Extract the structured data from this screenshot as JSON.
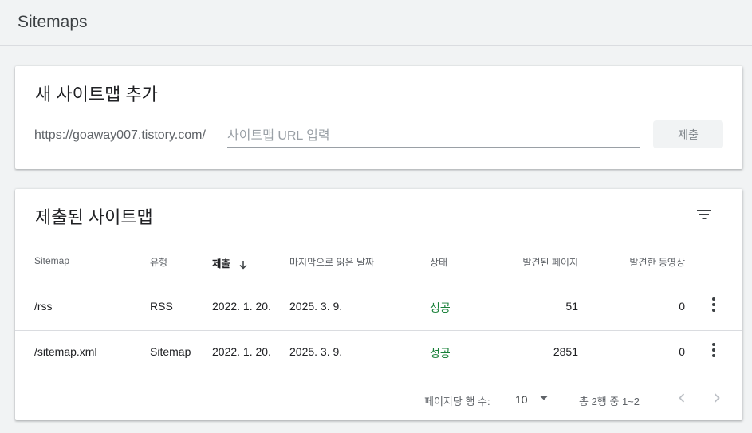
{
  "header": {
    "title": "Sitemaps"
  },
  "add_sitemap": {
    "title": "새 사이트맵 추가",
    "url_prefix": "https://goaway007.tistory.com/",
    "input_placeholder": "사이트맵 URL 입력",
    "input_value": "",
    "submit_label": "제출"
  },
  "submitted": {
    "title": "제출된 사이트맵",
    "filter_icon": "filter-icon",
    "columns": {
      "sitemap": "Sitemap",
      "type": "유형",
      "submitted": "제출",
      "last_read": "마지막으로 읽은 날짜",
      "status": "상태",
      "pages": "발견된 페이지",
      "videos": "발견한 동영상"
    },
    "sort_icon": "arrow-down-icon",
    "rows": [
      {
        "sitemap": "/rss",
        "type": "RSS",
        "submitted": "2022. 1. 20.",
        "last_read": "2025. 3. 9.",
        "status": "성공",
        "pages": "51",
        "videos": "0"
      },
      {
        "sitemap": "/sitemap.xml",
        "type": "Sitemap",
        "submitted": "2022. 1. 20.",
        "last_read": "2025. 3. 9.",
        "status": "성공",
        "pages": "2851",
        "videos": "0"
      }
    ],
    "pagination": {
      "rows_per_page_label": "페이지당 행 수:",
      "rows_per_page": "10",
      "range": "총 2행 중 1~2"
    }
  },
  "colors": {
    "status_success": "#188038",
    "background": "#f1f3f4"
  }
}
